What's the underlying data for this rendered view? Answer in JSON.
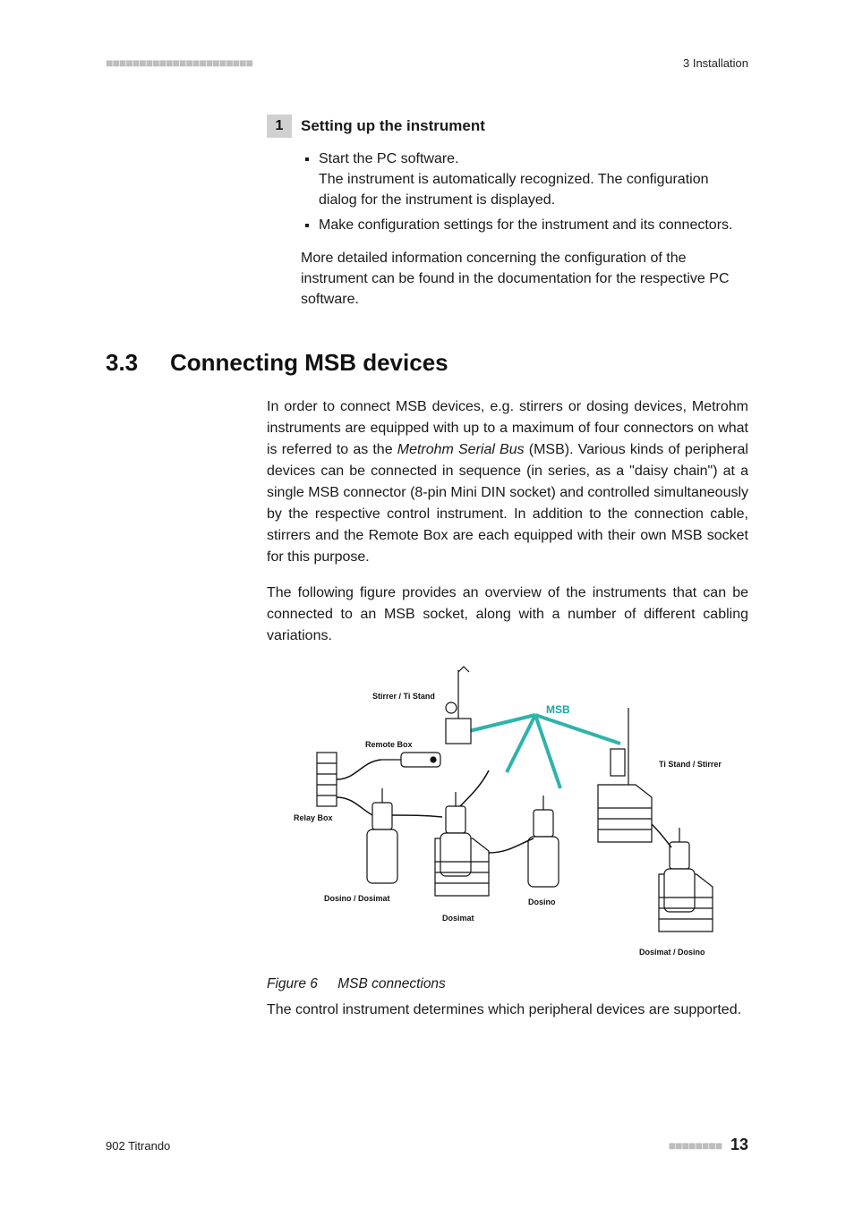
{
  "header": {
    "marks": "■■■■■■■■■■■■■■■■■■■■■■",
    "chapter": "3 Installation"
  },
  "step": {
    "number": "1",
    "title": "Setting up the instrument",
    "bullets": [
      "Start the PC software.",
      "The instrument is automatically recognized. The configuration dialog for the instrument is displayed.",
      "Make configuration settings for the instrument and its connectors."
    ],
    "after": "More detailed information concerning the configuration of the instrument can be found in the documentation for the respective PC software."
  },
  "section": {
    "number": "3.3",
    "title": "Connecting MSB devices"
  },
  "body": {
    "p1a": "In order to connect MSB devices, e.g. stirrers or dosing devices, Metrohm instruments are equipped with up to a maximum of four connectors on what is referred to as the ",
    "p1term": "Metrohm Serial Bus",
    "p1b": " (MSB). Various kinds of peripheral devices can be connected in sequence (in series, as a \"daisy chain\") at a single MSB connector (8-pin Mini DIN socket) and controlled simultaneously by the respective control instrument. In addition to the connection cable, stirrers and the Remote Box are each equipped with their own MSB socket for this purpose.",
    "p2": "The following figure provides an overview of the instruments that can be connected to an MSB socket, along with a number of different cabling variations."
  },
  "figure": {
    "msb": "MSB",
    "labels": {
      "stirrer_ti": "Stirrer / Ti Stand",
      "remote_box": "Remote Box",
      "relay_box": "Relay Box",
      "dosino_dosimat": "Dosino / Dosimat",
      "dosimat": "Dosimat",
      "dosino": "Dosino",
      "ti_stirrer": "Ti Stand / Stirrer",
      "dosimat_dosino": "Dosimat / Dosino"
    },
    "caption_label": "Figure 6",
    "caption_text": "MSB connections"
  },
  "after_figure": "The control instrument determines which peripheral devices are supported.",
  "footer": {
    "product": "902 Titrando",
    "marks": "■■■■■■■■",
    "page": "13"
  }
}
